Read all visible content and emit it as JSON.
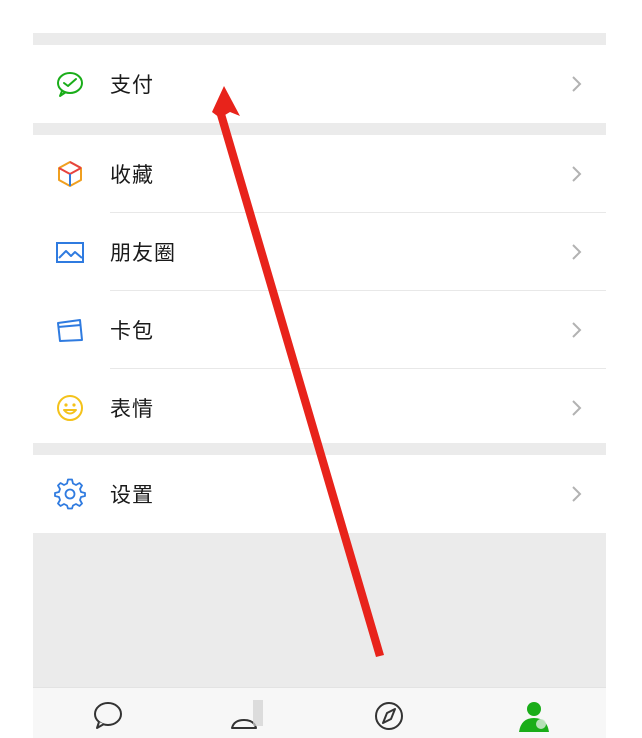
{
  "menu": {
    "pay": {
      "label": "支付",
      "icon": "pay-icon"
    },
    "favorites": {
      "label": "收藏",
      "icon": "cube-icon"
    },
    "moments": {
      "label": "朋友圈",
      "icon": "picture-icon"
    },
    "cards": {
      "label": "卡包",
      "icon": "card-icon"
    },
    "stickers": {
      "label": "表情",
      "icon": "smiley-icon"
    },
    "settings": {
      "label": "设置",
      "icon": "gear-icon"
    }
  },
  "tabbar": {
    "tabs": [
      {
        "name": "chats",
        "icon": "chat-bubble-icon"
      },
      {
        "name": "contacts",
        "icon": "contacts-icon"
      },
      {
        "name": "discover",
        "icon": "compass-icon"
      },
      {
        "name": "me",
        "icon": "person-icon",
        "active": true
      }
    ]
  },
  "colors": {
    "accent_green": "#1aad19",
    "annotation_red": "#e8231b",
    "section_gap": "#ebebeb",
    "chevron": "#b2b2b2"
  }
}
